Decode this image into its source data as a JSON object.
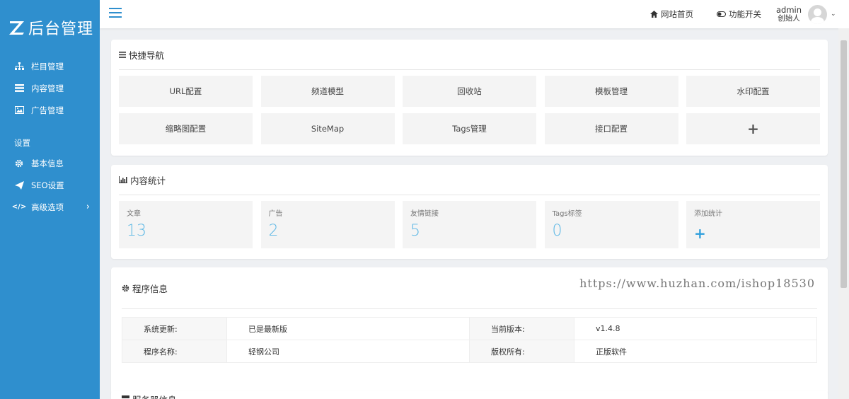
{
  "app": {
    "logo_text": "后台管理",
    "accent_color": "#2f8fce"
  },
  "sidebar": {
    "items": [
      {
        "label": "栏目管理",
        "icon": "sitemap-icon"
      },
      {
        "label": "内容管理",
        "icon": "list-icon"
      },
      {
        "label": "广告管理",
        "icon": "image-icon"
      }
    ],
    "section_label": "设置",
    "settings_items": [
      {
        "label": "基本信息",
        "icon": "gear-icon"
      },
      {
        "label": "SEO设置",
        "icon": "paper-plane-icon"
      },
      {
        "label": "高级选项",
        "icon": "code-icon",
        "arrow": "›"
      }
    ]
  },
  "header": {
    "home_link": "网站首页",
    "feature_toggle": "功能开关",
    "user_name": "admin",
    "user_role": "创始人"
  },
  "quick_nav": {
    "title": "快捷导航",
    "buttons": [
      "URL配置",
      "频道模型",
      "回收站",
      "模板管理",
      "水印配置",
      "缩略图配置",
      "SiteMap",
      "Tags管理",
      "接口配置",
      "+"
    ]
  },
  "stats": {
    "title": "内容统计",
    "cards": [
      {
        "label": "文章",
        "value": "13"
      },
      {
        "label": "广告",
        "value": "2"
      },
      {
        "label": "友情链接",
        "value": "5"
      },
      {
        "label": "Tags标签",
        "value": "0"
      },
      {
        "label": "添加统计",
        "value": "+"
      }
    ]
  },
  "program_info": {
    "title": "程序信息",
    "watermark": "https://www.huzhan.com/ishop18530",
    "rows": [
      {
        "k1": "系统更新:",
        "v1": "已是最新版",
        "k2": "当前版本:",
        "v2": "v1.4.8"
      },
      {
        "k1": "程序名称:",
        "v1": "轻钢公司",
        "k2": "版权所有:",
        "v2": "正版软件"
      }
    ]
  },
  "server_info": {
    "title": "服务器信息"
  }
}
